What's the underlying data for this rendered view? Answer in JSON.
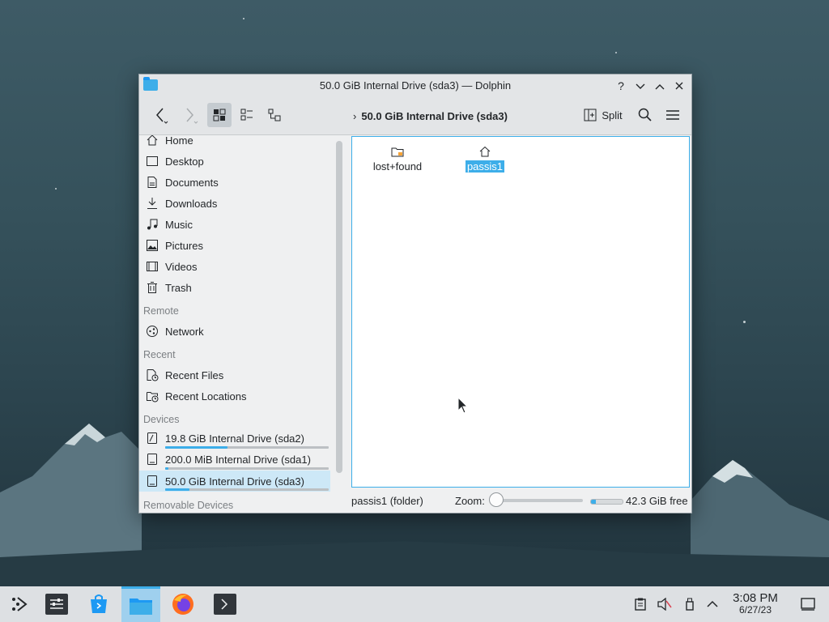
{
  "window": {
    "title": "50.0 GiB Internal Drive (sda3) — Dolphin",
    "help_glyph": "?",
    "app_icon": "folder-icon"
  },
  "toolbar": {
    "breadcrumb": "50.0 GiB Internal Drive (sda3)",
    "split_label": "Split",
    "view_mode_active": "icons"
  },
  "sidebar": {
    "places": [
      {
        "label": "Home",
        "icon": "home-icon"
      },
      {
        "label": "Desktop",
        "icon": "desktop-icon"
      },
      {
        "label": "Documents",
        "icon": "documents-icon"
      },
      {
        "label": "Downloads",
        "icon": "downloads-icon"
      },
      {
        "label": "Music",
        "icon": "music-icon"
      },
      {
        "label": "Pictures",
        "icon": "pictures-icon"
      },
      {
        "label": "Videos",
        "icon": "videos-icon"
      },
      {
        "label": "Trash",
        "icon": "trash-icon"
      }
    ],
    "remote_header": "Remote",
    "remote": [
      {
        "label": "Network",
        "icon": "network-icon"
      }
    ],
    "recent_header": "Recent",
    "recent": [
      {
        "label": "Recent Files",
        "icon": "recent-files-icon"
      },
      {
        "label": "Recent Locations",
        "icon": "recent-locations-icon"
      }
    ],
    "devices_header": "Devices",
    "devices": [
      {
        "label": "19.8 GiB Internal Drive (sda2)",
        "usage": 0.38
      },
      {
        "label": "200.0 MiB Internal Drive (sda1)",
        "usage": 0.02
      },
      {
        "label": "50.0 GiB Internal Drive (sda3)",
        "usage": 0.15,
        "selected": true
      }
    ],
    "removable_header": "Removable Devices"
  },
  "files": [
    {
      "name": "lost+found",
      "icon": "folder-locked-icon",
      "selected": false
    },
    {
      "name": "passis1",
      "icon": "home-folder-icon",
      "selected": true
    }
  ],
  "status": {
    "selection": "passis1 (folder)",
    "zoom_label": "Zoom:",
    "zoom_level": 0,
    "free_space": "42.3 GiB free",
    "used_fraction": 0.15
  },
  "taskbar": {
    "items": [
      "app-launcher",
      "system-settings",
      "discover",
      "dolphin",
      "firefox",
      "konsole"
    ],
    "active": "dolphin",
    "time": "3:08 PM",
    "date": "6/27/23"
  },
  "colors": {
    "accent": "#3daee9",
    "selection_bg": "#cde8f7"
  }
}
